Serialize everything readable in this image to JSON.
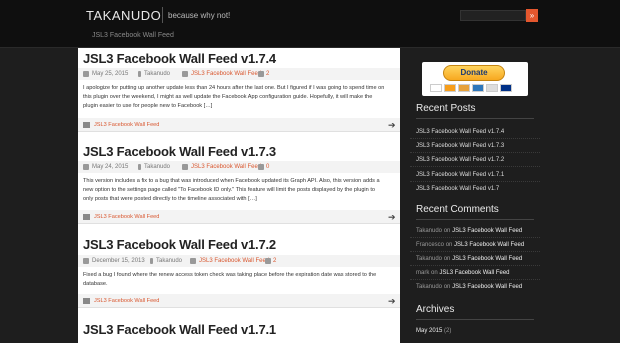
{
  "header": {
    "site_title": "TAKANUDO",
    "tagline": "because why not!",
    "nav_link": "JSL3 Facebook Wall Feed"
  },
  "posts": [
    {
      "title": "JSL3 Facebook Wall Feed v1.7.4",
      "date": "May 25, 2015",
      "author": "Takanudo",
      "category": "JSL3 Facebook Wall Feed",
      "comments": "2",
      "excerpt_lines": [
        "I apologize for putting up another update less than 24 hours after the last one. But I figured if I was going to spend time on",
        "this plugin over the weekend, I might as well update the Facebook App configuration guide. Hopefully, it will make the",
        "plugin easier to use for people new to Facebook […]"
      ],
      "footer_category": "JSL3 Facebook Wall Feed"
    },
    {
      "title": "JSL3 Facebook Wall Feed v1.7.3",
      "date": "May 24, 2015",
      "author": "Takanudo",
      "category": "JSL3 Facebook Wall Feed",
      "comments": "0",
      "excerpt_lines": [
        "This version includes a fix to a bug that was introduced when Facebook updated its Graph API. Also, this version adds a",
        "new option to the settings page called \"To Facebook ID only.\" This feature will limit the posts displayed by the plugin to",
        "only posts that were posted directly to the timeline associated with […]"
      ],
      "footer_category": "JSL3 Facebook Wall Feed"
    },
    {
      "title": "JSL3 Facebook Wall Feed v1.7.2",
      "date": "December 15, 2013",
      "author": "Takanudo",
      "category": "JSL3 Facebook Wall Feed",
      "comments": "2",
      "excerpt_lines": [
        "Fixed a bug I found where the renew access token check was taking place before the expiration date was stored to the",
        "database."
      ],
      "footer_category": "JSL3 Facebook Wall Feed"
    },
    {
      "title": "JSL3 Facebook Wall Feed v1.7.1"
    }
  ],
  "sidebar": {
    "donate_label": "Donate",
    "recent_posts_title": "Recent Posts",
    "recent_posts": [
      "JSL3 Facebook Wall Feed v1.7.4",
      "JSL3 Facebook Wall Feed v1.7.3",
      "JSL3 Facebook Wall Feed v1.7.2",
      "JSL3 Facebook Wall Feed v1.7.1",
      "JSL3 Facebook Wall Feed v1.7"
    ],
    "recent_comments_title": "Recent Comments",
    "recent_comments": [
      {
        "author": "Takanudo",
        "on": "on",
        "post": "JSL3 Facebook Wall Feed"
      },
      {
        "author": "Francesco",
        "on": "on",
        "post": "JSL3 Facebook Wall Feed"
      },
      {
        "author": "Takanudo",
        "on": "on",
        "post": "JSL3 Facebook Wall Feed"
      },
      {
        "author": "mark",
        "on": "on",
        "post": "JSL3 Facebook Wall Feed"
      },
      {
        "author": "Takanudo",
        "on": "on",
        "post": "JSL3 Facebook Wall Feed"
      }
    ],
    "archives_title": "Archives",
    "archives": [
      {
        "month": "May 2015",
        "count": "(2)"
      }
    ]
  },
  "colors": {
    "accent": "#d9572f",
    "background": "#1e1e1e"
  }
}
